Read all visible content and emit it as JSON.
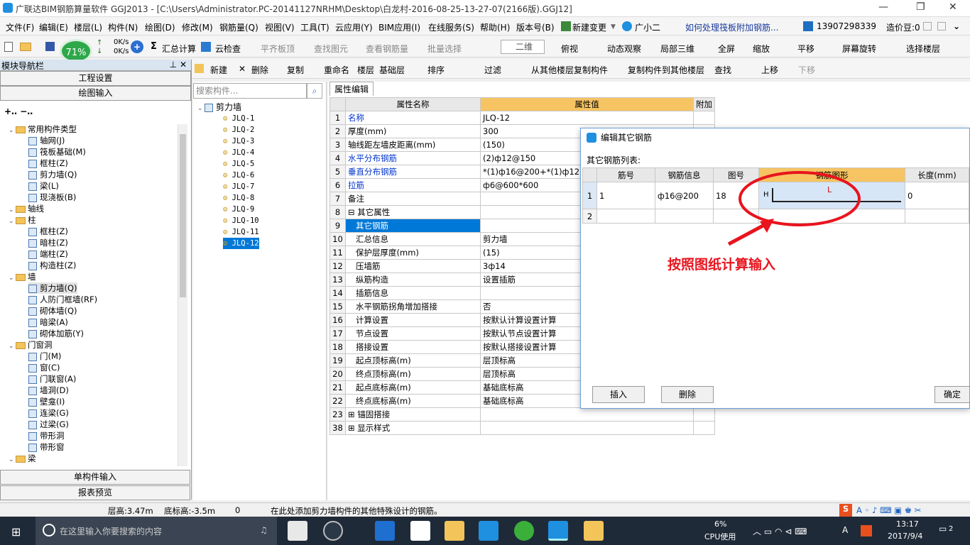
{
  "title": {
    "text": "广联达BIM钢筋算量软件 GGJ2013 - [C:\\Users\\Administrator.PC-20141127NRHM\\Desktop\\白龙村-2016-08-25-13-27-07(2166版).GGJ12]"
  },
  "menu": {
    "items": [
      "文件(F)",
      "编辑(E)",
      "楼层(L)",
      "构件(N)",
      "绘图(D)",
      "修改(M)",
      "钢筋量(Q)",
      "视图(V)",
      "工具(T)",
      "云应用(Y)",
      "BIM应用(I)",
      "在线服务(S)",
      "帮助(H)",
      "版本号(B)",
      "新建变更",
      "广小二"
    ],
    "question": "如何处理筏板附加钢筋...",
    "phone": "13907298339",
    "price": "造价豆:0"
  },
  "toolbar1": {
    "speed_pct": "71%",
    "up_speed": "0K/s",
    "down_speed": "0K/s",
    "items": [
      "汇总计算",
      "云检查",
      "平齐板顶",
      "查找图元",
      "查看钢筋量",
      "批量选择",
      "二维",
      "俯视",
      "动态观察",
      "局部三维",
      "全屏",
      "缩放",
      "平移",
      "屏幕旋转",
      "选择楼层"
    ]
  },
  "toolbar2": {
    "items": [
      "新建",
      "删除",
      "复制",
      "重命名",
      "楼层",
      "基础层",
      "排序",
      "过滤",
      "从其他楼层复制构件",
      "复制构件到其他楼层",
      "查找",
      "上移",
      "下移"
    ]
  },
  "nav": {
    "header": "模块导航栏",
    "btn_setup": "工程设置",
    "btn_draw": "绘图输入",
    "btn_single": "单构件输入",
    "btn_report": "报表预览",
    "tree": [
      {
        "label": "常用构件类型",
        "level": 0,
        "type": "folder"
      },
      {
        "label": "轴网(J)",
        "level": 1
      },
      {
        "label": "筏板基础(M)",
        "level": 1
      },
      {
        "label": "框柱(Z)",
        "level": 1
      },
      {
        "label": "剪力墙(Q)",
        "level": 1
      },
      {
        "label": "梁(L)",
        "level": 1
      },
      {
        "label": "现浇板(B)",
        "level": 1
      },
      {
        "label": "轴线",
        "level": 0,
        "type": "folder"
      },
      {
        "label": "柱",
        "level": 0,
        "type": "folder"
      },
      {
        "label": "框柱(Z)",
        "level": 1
      },
      {
        "label": "暗柱(Z)",
        "level": 1
      },
      {
        "label": "端柱(Z)",
        "level": 1
      },
      {
        "label": "构造柱(Z)",
        "level": 1
      },
      {
        "label": "墙",
        "level": 0,
        "type": "folder"
      },
      {
        "label": "剪力墙(Q)",
        "level": 1
      },
      {
        "label": "人防门框墙(RF)",
        "level": 1
      },
      {
        "label": "砌体墙(Q)",
        "level": 1
      },
      {
        "label": "暗梁(A)",
        "level": 1
      },
      {
        "label": "砌体加筋(Y)",
        "level": 1
      },
      {
        "label": "门窗洞",
        "level": 0,
        "type": "folder"
      },
      {
        "label": "门(M)",
        "level": 1
      },
      {
        "label": "窗(C)",
        "level": 1
      },
      {
        "label": "门联窗(A)",
        "level": 1
      },
      {
        "label": "墙洞(D)",
        "level": 1
      },
      {
        "label": "壁龛(I)",
        "level": 1
      },
      {
        "label": "连梁(G)",
        "level": 1
      },
      {
        "label": "过梁(G)",
        "level": 1
      },
      {
        "label": "带形洞",
        "level": 1
      },
      {
        "label": "带形窗",
        "level": 1
      },
      {
        "label": "梁",
        "level": 0,
        "type": "folder"
      }
    ]
  },
  "components": {
    "search_placeholder": "搜索构件...",
    "root": "剪力墙",
    "items": [
      "JLQ-1",
      "JLQ-2",
      "JLQ-3",
      "JLQ-4",
      "JLQ-5",
      "JLQ-6",
      "JLQ-7",
      "JLQ-8",
      "JLQ-9",
      "JLQ-10",
      "JLQ-11",
      "JLQ-12"
    ]
  },
  "props": {
    "tab": "属性编辑",
    "col_name": "属性名称",
    "col_value": "属性值",
    "col_extra": "附加",
    "rows": [
      {
        "n": "1",
        "k": "名称",
        "v": "JLQ-12",
        "blue": true
      },
      {
        "n": "2",
        "k": "厚度(mm)",
        "v": "300"
      },
      {
        "n": "3",
        "k": "轴线距左墙皮距离(mm)",
        "v": "(150)"
      },
      {
        "n": "4",
        "k": "水平分布钢筋",
        "v": "(2)ф12@150",
        "blue": true
      },
      {
        "n": "5",
        "k": "垂直分布钢筋",
        "v": "*(1)ф16@200+*(1)ф12@1",
        "blue": true
      },
      {
        "n": "6",
        "k": "拉筋",
        "v": "ф6@600*600",
        "blue": true
      },
      {
        "n": "7",
        "k": "备注",
        "v": ""
      },
      {
        "n": "8",
        "k": "⊟ 其它属性",
        "v": ""
      },
      {
        "n": "9",
        "k": "其它钢筋",
        "v": "",
        "sel": true
      },
      {
        "n": "10",
        "k": "汇总信息",
        "v": "剪力墙"
      },
      {
        "n": "11",
        "k": "保护层厚度(mm)",
        "v": "(15)"
      },
      {
        "n": "12",
        "k": "压墙筋",
        "v": "3ф14"
      },
      {
        "n": "13",
        "k": "纵筋构造",
        "v": "设置插筋"
      },
      {
        "n": "14",
        "k": "插筋信息",
        "v": ""
      },
      {
        "n": "15",
        "k": "水平钢筋拐角增加搭接",
        "v": "否"
      },
      {
        "n": "16",
        "k": "计算设置",
        "v": "按默认计算设置计算"
      },
      {
        "n": "17",
        "k": "节点设置",
        "v": "按默认节点设置计算"
      },
      {
        "n": "18",
        "k": "搭接设置",
        "v": "按默认搭接设置计算"
      },
      {
        "n": "19",
        "k": "起点顶标高(m)",
        "v": "层顶标高"
      },
      {
        "n": "20",
        "k": "终点顶标高(m)",
        "v": "层顶标高"
      },
      {
        "n": "21",
        "k": "起点底标高(m)",
        "v": "基础底标高"
      },
      {
        "n": "22",
        "k": "终点底标高(m)",
        "v": "基础底标高"
      },
      {
        "n": "23",
        "k": "⊞ 锚固搭接",
        "v": ""
      },
      {
        "n": "38",
        "k": "⊞ 显示样式",
        "v": ""
      }
    ]
  },
  "dialog": {
    "title": "编辑其它钢筋",
    "list_label": "其它钢筋列表:",
    "headers": [
      "筋号",
      "钢筋信息",
      "图号",
      "钢筋图形",
      "长度(mm)"
    ],
    "rows": [
      {
        "n": "1",
        "jh": "1",
        "info": "ф16@200",
        "tuhao": "18",
        "shape_h": "H",
        "shape_l": "L",
        "len": "0"
      },
      {
        "n": "2",
        "jh": "",
        "info": "",
        "tuhao": "",
        "shape_h": "",
        "shape_l": "",
        "len": ""
      }
    ],
    "btn_insert": "插入",
    "btn_delete": "删除",
    "btn_ok": "确定"
  },
  "annotation": "按照图纸计算输入",
  "status": {
    "floor_height": "层高:3.47m",
    "bottom_elev": "底标高:-3.5m",
    "zero": "0",
    "hint": "在此处添加剪力墙构件的其他特殊设计的钢筋。"
  },
  "taskbar": {
    "search_placeholder": "在这里输入你要搜索的内容",
    "cpu_pct": "6%",
    "cpu_label": "CPU使用",
    "time": "13:17",
    "date": "2017/9/4",
    "ime": "A",
    "notif": "2"
  },
  "colors": {
    "accent": "#0078d7",
    "annot": "#e8141e",
    "header_highlight": "#f6c462"
  }
}
